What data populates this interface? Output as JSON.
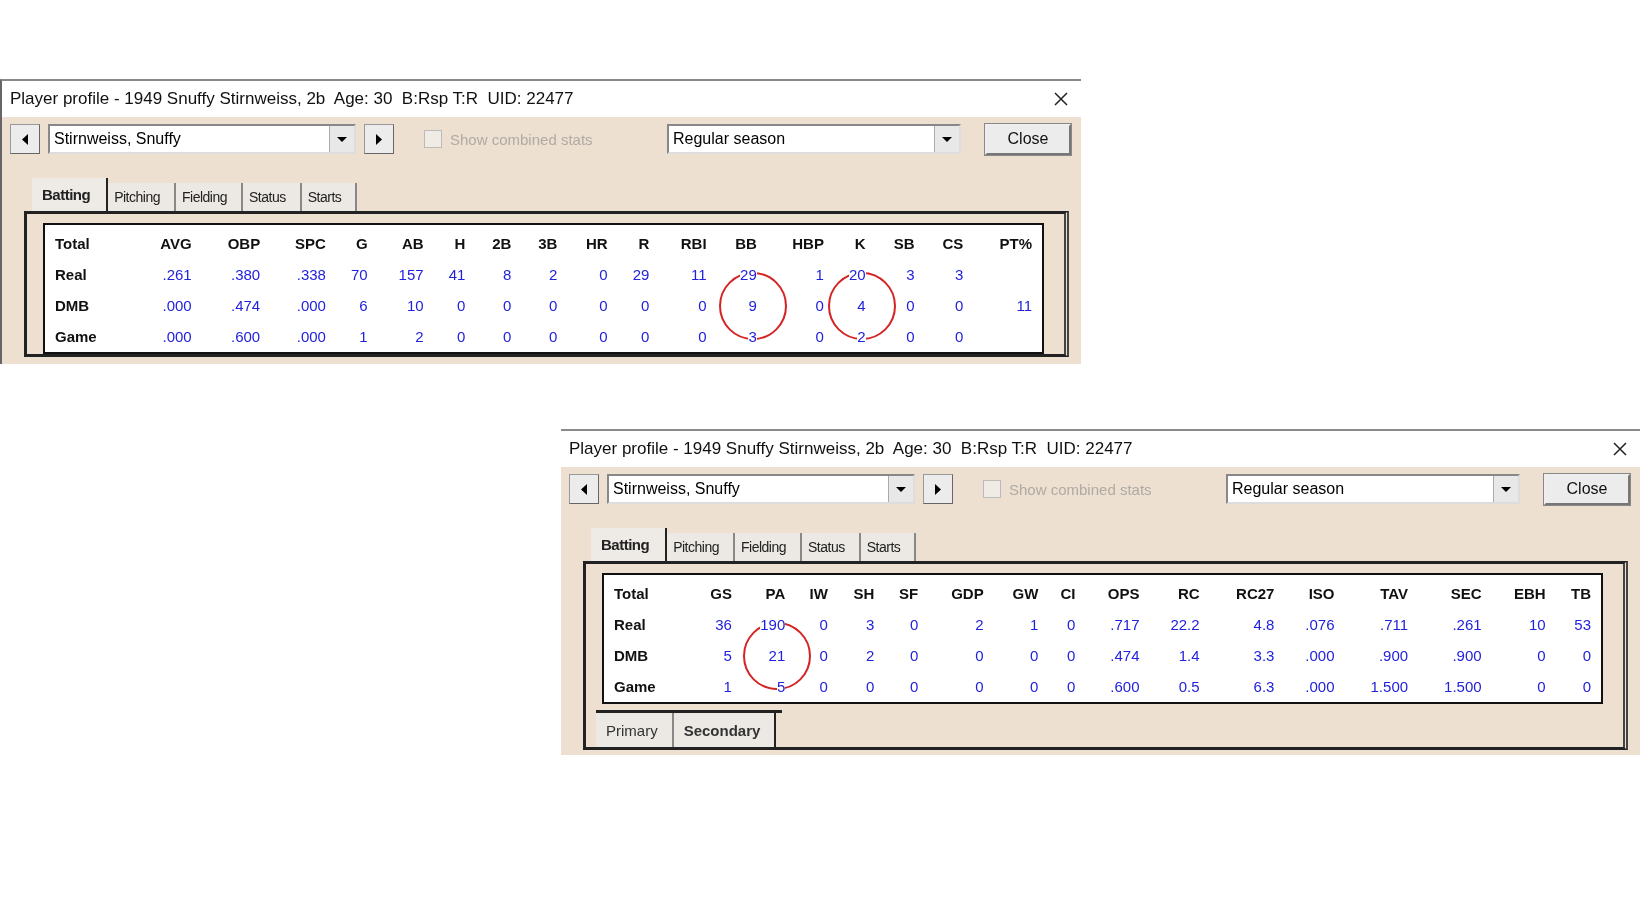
{
  "windows": [
    {
      "title": "Player profile - 1949 Snuffy Stirnweiss, 2b  Age: 30  B:Rsp T:R  UID: 22477",
      "player": "Stirnweiss, Snuffy",
      "show_combined": {
        "label": "Show combined stats",
        "checked": false,
        "disabled": true
      },
      "season": "Regular season",
      "close_label": "Close",
      "tabs": [
        {
          "label": "Batting",
          "selected": true
        },
        {
          "label": "Pitching",
          "selected": false
        },
        {
          "label": "Fielding",
          "selected": false
        },
        {
          "label": "Status",
          "selected": false
        },
        {
          "label": "Starts",
          "selected": false
        }
      ],
      "table": {
        "corner": "Total",
        "columns": [
          {
            "label": "AVG",
            "circled": false
          },
          {
            "label": "OBP",
            "circled": false
          },
          {
            "label": "SPC",
            "circled": false
          },
          {
            "label": "G",
            "circled": false
          },
          {
            "label": "AB",
            "circled": false
          },
          {
            "label": "H",
            "circled": false
          },
          {
            "label": "2B",
            "circled": false
          },
          {
            "label": "3B",
            "circled": false
          },
          {
            "label": "HR",
            "circled": false
          },
          {
            "label": "R",
            "circled": false
          },
          {
            "label": "RBI",
            "circled": false
          },
          {
            "label": "BB",
            "circled": true
          },
          {
            "label": "HBP",
            "circled": false
          },
          {
            "label": "K",
            "circled": true
          },
          {
            "label": "SB",
            "circled": false
          },
          {
            "label": "CS",
            "circled": false
          },
          {
            "label": "PT%",
            "circled": false
          }
        ],
        "rows": [
          {
            "label": "Real",
            "cells": [
              ".261",
              ".380",
              ".338",
              "70",
              "157",
              "41",
              "8",
              "2",
              "0",
              "29",
              "11",
              "29",
              "1",
              "20",
              "3",
              "3",
              null
            ]
          },
          {
            "label": "DMB",
            "cells": [
              ".000",
              ".474",
              ".000",
              "6",
              "10",
              "0",
              "0",
              "0",
              "0",
              "0",
              "0",
              "9",
              "0",
              "4",
              "0",
              "0",
              "11"
            ]
          },
          {
            "label": "Game",
            "cells": [
              ".000",
              ".600",
              ".000",
              "1",
              "2",
              "0",
              "0",
              "0",
              "0",
              "0",
              "0",
              "3",
              "0",
              "2",
              "0",
              "0",
              null
            ]
          }
        ]
      }
    },
    {
      "title": "Player profile - 1949 Snuffy Stirnweiss, 2b  Age: 30  B:Rsp T:R  UID: 22477",
      "player": "Stirnweiss, Snuffy",
      "show_combined": {
        "label": "Show combined stats",
        "checked": false,
        "disabled": true
      },
      "season": "Regular season",
      "close_label": "Close",
      "tabs": [
        {
          "label": "Batting",
          "selected": true
        },
        {
          "label": "Pitching",
          "selected": false
        },
        {
          "label": "Fielding",
          "selected": false
        },
        {
          "label": "Status",
          "selected": false
        },
        {
          "label": "Starts",
          "selected": false
        }
      ],
      "table": {
        "corner": "Total",
        "columns": [
          {
            "label": "GS",
            "circled": false
          },
          {
            "label": "PA",
            "circled": true
          },
          {
            "label": "IW",
            "circled": false
          },
          {
            "label": "SH",
            "circled": false
          },
          {
            "label": "SF",
            "circled": false
          },
          {
            "label": "GDP",
            "circled": false
          },
          {
            "label": "GW",
            "circled": false
          },
          {
            "label": "CI",
            "circled": false
          },
          {
            "label": "OPS",
            "circled": false
          },
          {
            "label": "RC",
            "circled": false
          },
          {
            "label": "RC27",
            "circled": false
          },
          {
            "label": "ISO",
            "circled": false
          },
          {
            "label": "TAV",
            "circled": false
          },
          {
            "label": "SEC",
            "circled": false
          },
          {
            "label": "EBH",
            "circled": false
          },
          {
            "label": "TB",
            "circled": false
          }
        ],
        "rows": [
          {
            "label": "Real",
            "cells": [
              "36",
              "190",
              "0",
              "3",
              "0",
              "2",
              "1",
              "0",
              ".717",
              "22.2",
              "4.8",
              ".076",
              ".711",
              ".261",
              "10",
              "53"
            ]
          },
          {
            "label": "DMB",
            "cells": [
              "5",
              "21",
              "0",
              "2",
              "0",
              "0",
              "0",
              "0",
              ".474",
              "1.4",
              "3.3",
              ".000",
              ".900",
              ".900",
              "0",
              "0"
            ]
          },
          {
            "label": "Game",
            "cells": [
              "1",
              "5",
              "0",
              "0",
              "0",
              "0",
              "0",
              "0",
              ".600",
              "0.5",
              "6.3",
              ".000",
              "1.500",
              "1.500",
              "0",
              "0"
            ]
          }
        ]
      },
      "subtabs": [
        {
          "label": "Primary",
          "selected": false
        },
        {
          "label": "Secondary",
          "selected": true
        }
      ]
    }
  ]
}
